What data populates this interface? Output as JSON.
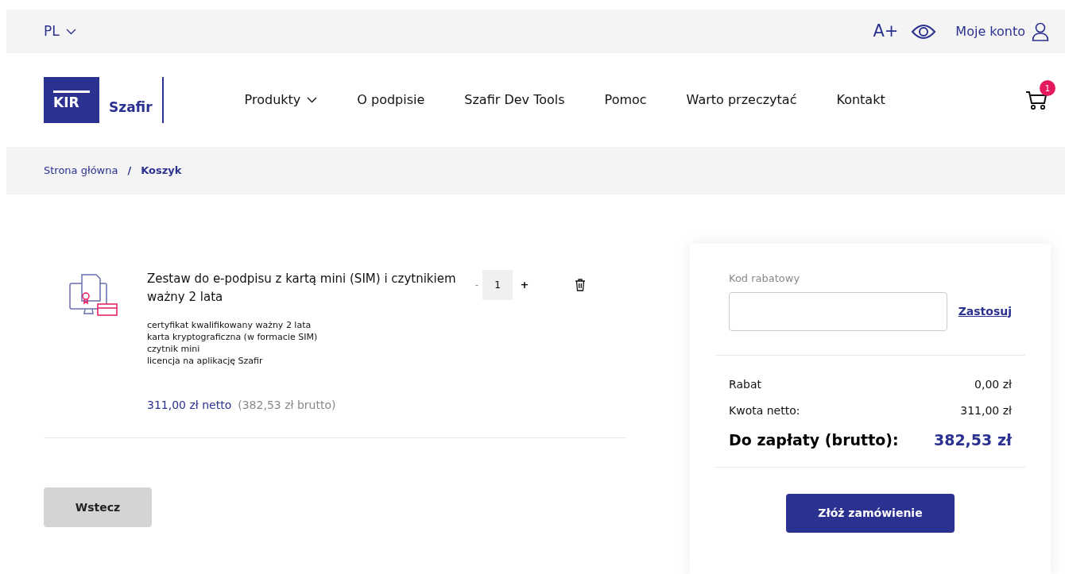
{
  "top_bar": {
    "language": "PL",
    "font_size": "A+",
    "account": "Moje konto"
  },
  "logo": {
    "mark": "KIR",
    "name": "Szafir"
  },
  "nav": [
    {
      "label": "Produkty",
      "dropdown": true
    },
    {
      "label": "O podpisie",
      "dropdown": false
    },
    {
      "label": "Szafir Dev Tools",
      "dropdown": false
    },
    {
      "label": "Pomoc",
      "dropdown": false
    },
    {
      "label": "Warto przeczytać",
      "dropdown": false
    },
    {
      "label": "Kontakt",
      "dropdown": false
    }
  ],
  "cart_count": "1",
  "breadcrumb": [
    {
      "label": "Strona główna",
      "selected": false
    },
    {
      "label": "Koszyk",
      "selected": true
    }
  ],
  "breadcrumb_separator": "/",
  "cart_items": [
    {
      "title": "Zestaw do e-podpisu z kartą mini (SIM) i czytnikiem ważny 2 lata",
      "features": [
        "certyfikat kwalifikowany ważny 2 lata",
        "karta kryptograficzna (w formacie SIM)",
        "czytnik mini",
        "licencja na aplikację Szafir"
      ],
      "quantity": "1",
      "minus": "-",
      "plus": "+",
      "net_price": "311,00 zł netto",
      "gross_price": "(382,53 zł brutto)"
    }
  ],
  "back_button": "Wstecz",
  "summary": {
    "discount_label": "Kod rabatowy",
    "apply": "Zastosuj",
    "rows": [
      {
        "label": "Rabat",
        "value": "0,00 zł",
        "kind": "normal"
      },
      {
        "label": "Kwota netto:",
        "value": "311,00 zł",
        "kind": "normal"
      },
      {
        "label": "Do zapłaty (brutto):",
        "value": "382,53 zł",
        "kind": "total"
      }
    ],
    "order_button": "Złóż zamówienie"
  }
}
